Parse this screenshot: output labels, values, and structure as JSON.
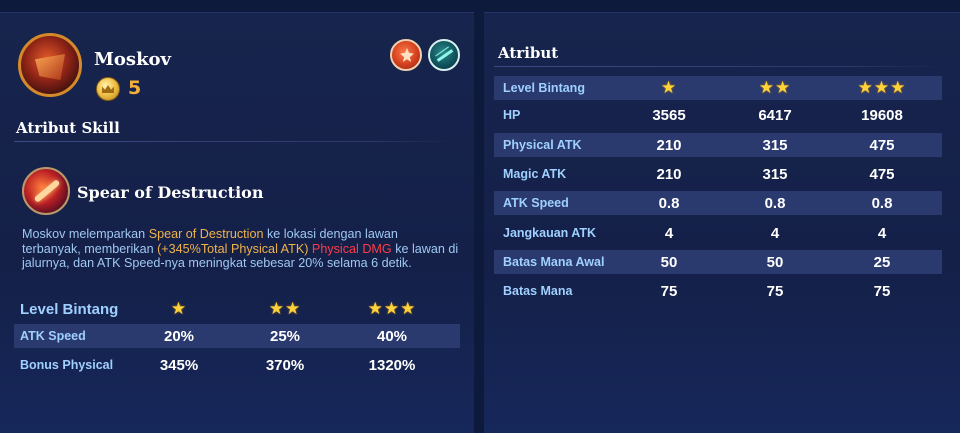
{
  "hero": {
    "name": "Moskov",
    "cost": "5",
    "roles": [
      "fighter-icon",
      "marksman-icon"
    ]
  },
  "skill_section": {
    "title": "Atribut Skill",
    "skill_name": "Spear of Destruction",
    "description": {
      "part1": "Moskov melemparkan ",
      "highlight1": "Spear of Destruction",
      "part2": " ke lokasi dengan lawan terbanyak, memberikan  ",
      "highlight2": "(+345%Total Physical ATK)",
      "part3": " ",
      "highlight3": "Physical DMG",
      "part4": " ke lawan di jalurnya, dan ATK Speed-nya meningkat sebesar 20% selama 6 detik."
    },
    "table": {
      "header_label": "Level Bintang",
      "stars": [
        "★",
        "★★",
        "★★★"
      ],
      "rows": [
        {
          "label": "ATK Speed",
          "values": [
            "20%",
            "25%",
            "40%"
          ]
        },
        {
          "label": "Bonus Physical",
          "values": [
            "345%",
            "370%",
            "1320%"
          ]
        }
      ]
    }
  },
  "attr_section": {
    "title": "Atribut",
    "table": {
      "header_label": "Level Bintang",
      "stars": [
        "★",
        "★★",
        "★★★"
      ],
      "rows": [
        {
          "label": "HP",
          "values": [
            "3565",
            "6417",
            "19608"
          ]
        },
        {
          "label": "Physical ATK",
          "values": [
            "210",
            "315",
            "475"
          ]
        },
        {
          "label": "Magic ATK",
          "values": [
            "210",
            "315",
            "475"
          ]
        },
        {
          "label": "ATK Speed",
          "values": [
            "0.8",
            "0.8",
            "0.8"
          ]
        },
        {
          "label": "Jangkauan ATK",
          "values": [
            "4",
            "4",
            "4"
          ]
        },
        {
          "label": "Batas Mana Awal",
          "values": [
            "50",
            "50",
            "25"
          ]
        },
        {
          "label": "Batas Mana",
          "values": [
            "75",
            "75",
            "75"
          ]
        }
      ]
    }
  },
  "colors": {
    "background": "#0e1a3c",
    "panel": "#17244d",
    "band": "#2a3a6e",
    "label_blue": "#9fd0ff",
    "cost_gold": "#f4b03a",
    "highlight_orange": "#f0b24a",
    "highlight_red": "#ff3b48"
  }
}
